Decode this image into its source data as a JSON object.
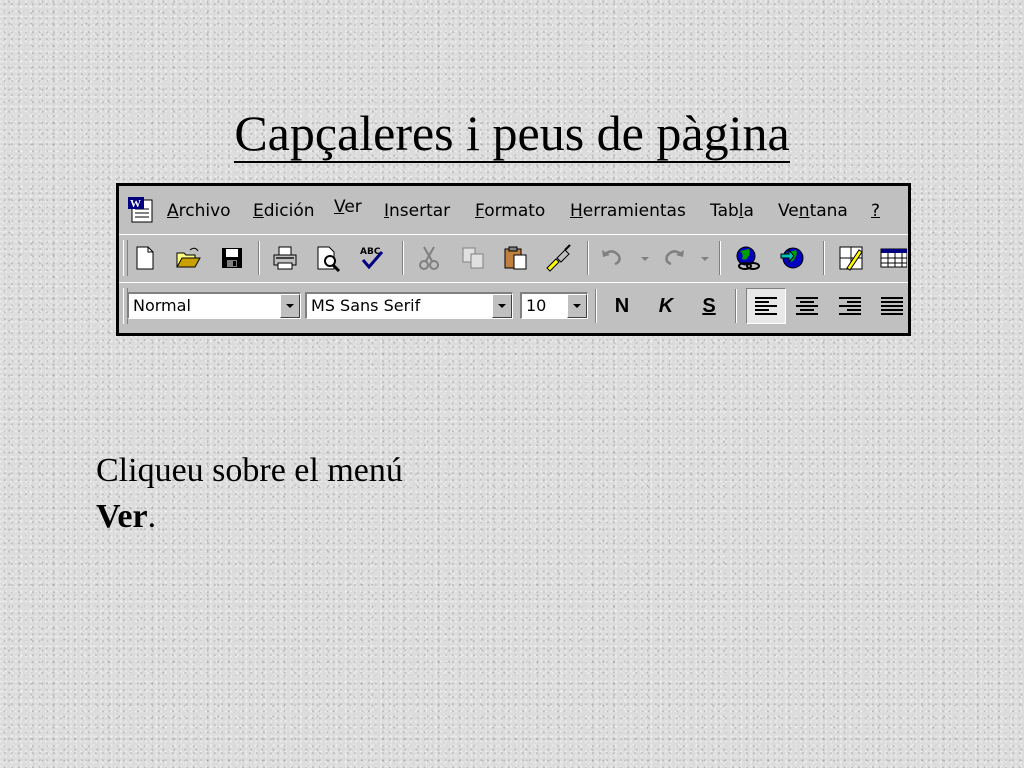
{
  "slide": {
    "title": "Capçaleres i peus de pàgina",
    "instruction_text": "Cliqueu sobre el menú",
    "instruction_bold": "Ver",
    "instruction_end": "."
  },
  "menubar": {
    "items": [
      {
        "u": "A",
        "rest": "rchivo"
      },
      {
        "u": "E",
        "rest": "dición"
      },
      {
        "u": "V",
        "rest": "er"
      },
      {
        "u": "I",
        "rest": "nsertar"
      },
      {
        "u": "F",
        "rest": "ormato"
      },
      {
        "u": "H",
        "rest": "erramientas"
      },
      {
        "pre": "Tab",
        "u": "l",
        "rest": "a"
      },
      {
        "pre": "Ve",
        "u": "n",
        "rest": "tana"
      },
      {
        "u": "?",
        "rest": ""
      }
    ]
  },
  "standard_toolbar": {
    "icons": [
      "new-document-icon",
      "open-folder-icon",
      "save-icon",
      "print-icon",
      "print-preview-icon",
      "spelling-icon",
      "cut-icon",
      "copy-icon",
      "paste-icon",
      "format-painter-icon",
      "undo-icon",
      "redo-icon",
      "insert-hyperlink-icon",
      "web-toolbar-icon",
      "tables-borders-icon",
      "insert-table-icon"
    ]
  },
  "formatting_toolbar": {
    "style_value": "Normal",
    "font_value": "MS Sans Serif",
    "size_value": "10",
    "bold_label": "N",
    "italic_label": "K",
    "underline_label": "S",
    "alignment_icons": [
      "align-left-icon",
      "align-center-icon",
      "align-right-icon",
      "justify-icon"
    ],
    "pressed": "align-left"
  },
  "colors": {
    "toolbar_bg": "#c0c0c0",
    "shadow": "#808080",
    "highlight": "#ffffff",
    "icon_blue": "#000080",
    "icon_yellow": "#ffff00",
    "slide_bg": "#dcdcdc"
  }
}
